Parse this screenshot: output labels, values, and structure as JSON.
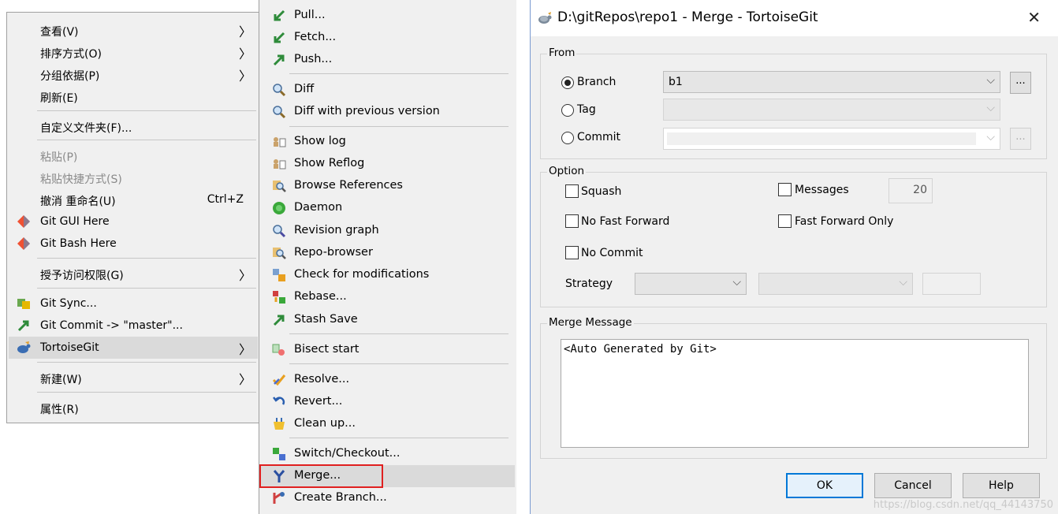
{
  "context_menu": {
    "items": [
      {
        "label": "查看(V)",
        "submenu": true
      },
      {
        "label": "排序方式(O)",
        "submenu": true
      },
      {
        "label": "分组依据(P)",
        "submenu": true
      },
      {
        "label": "刷新(E)"
      },
      {
        "label": "自定义文件夹(F)..."
      },
      {
        "label": "粘贴(P)",
        "disabled": true
      },
      {
        "label": "粘贴快捷方式(S)",
        "disabled": true
      },
      {
        "label": "撤消 重命名(U)",
        "shortcut": "Ctrl+Z"
      },
      {
        "label": "Git GUI Here",
        "icon": "git-diamond-icon"
      },
      {
        "label": "Git Bash Here",
        "icon": "git-diamond-icon"
      },
      {
        "label": "授予访问权限(G)",
        "submenu": true
      },
      {
        "label": "Git Sync...",
        "icon": "git-sync-icon"
      },
      {
        "label": "Git Commit -> \"master\"...",
        "icon": "commit-arrow-icon"
      },
      {
        "label": "TortoiseGit",
        "icon": "tortoise-icon",
        "submenu": true,
        "highlighted": true
      },
      {
        "label": "新建(W)",
        "submenu": true
      },
      {
        "label": "属性(R)"
      }
    ]
  },
  "tortoise_menu": {
    "items": [
      {
        "label": "Pull...",
        "icon": "pull-icon"
      },
      {
        "label": "Fetch...",
        "icon": "fetch-icon"
      },
      {
        "label": "Push...",
        "icon": "push-icon"
      },
      {
        "label": "Diff",
        "icon": "diff-icon"
      },
      {
        "label": "Diff with previous version",
        "icon": "diff-icon"
      },
      {
        "label": "Show log",
        "icon": "show-log-icon"
      },
      {
        "label": "Show Reflog",
        "icon": "show-log-icon"
      },
      {
        "label": "Browse References",
        "icon": "browse-icon"
      },
      {
        "label": "Daemon",
        "icon": "daemon-icon"
      },
      {
        "label": "Revision graph",
        "icon": "revision-graph-icon"
      },
      {
        "label": "Repo-browser",
        "icon": "repo-browser-icon"
      },
      {
        "label": "Check for modifications",
        "icon": "check-modifications-icon"
      },
      {
        "label": "Rebase...",
        "icon": "rebase-icon"
      },
      {
        "label": "Stash Save",
        "icon": "stash-icon"
      },
      {
        "label": "Bisect start",
        "icon": "bisect-icon"
      },
      {
        "label": "Resolve...",
        "icon": "resolve-icon"
      },
      {
        "label": "Revert...",
        "icon": "revert-icon"
      },
      {
        "label": "Clean up...",
        "icon": "cleanup-icon"
      },
      {
        "label": "Switch/Checkout...",
        "icon": "switch-icon"
      },
      {
        "label": "Merge...",
        "icon": "merge-icon",
        "highlighted": true
      },
      {
        "label": "Create Branch...",
        "icon": "create-branch-icon"
      }
    ]
  },
  "dialog": {
    "title": "D:\\gitRepos\\repo1 - Merge - TortoiseGit",
    "close": "✕",
    "from": {
      "label": "From",
      "branch_label": "Branch",
      "branch_value": "b1",
      "tag_label": "Tag",
      "commit_label": "Commit",
      "browse": "...",
      "selected": "branch"
    },
    "option": {
      "label": "Option",
      "squash": "Squash",
      "messages": "Messages",
      "messages_count": "20",
      "no_fast_forward": "No Fast Forward",
      "fast_forward_only": "Fast Forward Only",
      "no_commit": "No Commit",
      "strategy": "Strategy"
    },
    "merge_message": {
      "label": "Merge Message",
      "text": "<Auto Generated by Git>"
    },
    "buttons": {
      "ok": "OK",
      "cancel": "Cancel",
      "help": "Help"
    }
  },
  "watermark": "https://blog.csdn.net/qq_44143750",
  "colors": {
    "highlight_box": "#e02020",
    "menu_bg": "#f0f0f0",
    "selected_row": "#dadada"
  }
}
